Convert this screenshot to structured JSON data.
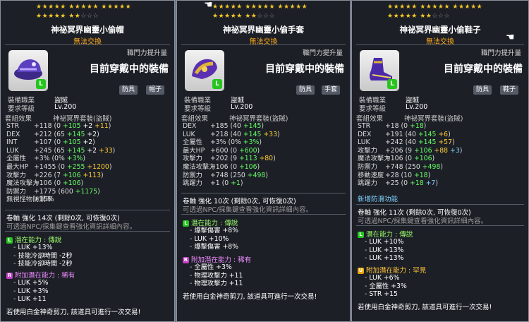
{
  "colors": {
    "title": "#ffffff",
    "untradeable": "#ffaa1e",
    "bonus_green": "#66ff66",
    "bonus_yellow": "#ffcc33",
    "scroll_cyan": "#7fd4ff",
    "legendary": "#26c41f",
    "rare": "#c33ec7",
    "unique": "#e8a600"
  },
  "common": {
    "upgrade_label": "職門力提升量",
    "equipped_label": "目前穿戴中的裝備",
    "job_label": "裝備職業",
    "job_value": "盜賊",
    "level_label": "要求等級",
    "level_value": "Lv.200",
    "set_label": "套組效果",
    "untradeable": "無法交換",
    "upgrade_note": "可透過NPC/採集鍵查看強化資訊詳細內容。",
    "potential_label": "潛在能力 : 傳說",
    "scissors_text": "若使用白金神奇剪刀, 該道具可進行一次交易!"
  },
  "items": [
    {
      "title": "神祕冥界幽靈小偷帽",
      "type_tags": [
        "防具",
        "帽子"
      ],
      "set_name": "神祕冥界套裝(盜賊)",
      "stars_row1": "★★★★★ ★★★★★ ★★★★★",
      "stars_row2": "★★★★★ ★★☆☆☆",
      "stats": [
        {
          "nm": "STR",
          "v": "+118 (0 ",
          "a": "+105",
          "b": "+2",
          "c": "+11",
          ")": ")"
        },
        {
          "nm": "DEX",
          "v": "+212 (65 ",
          "a": "+145",
          "b": "+2",
          ")": ")"
        },
        {
          "nm": "INT",
          "v": "+107 (0 ",
          "a": "+105",
          "b": "+2",
          ")": ")"
        },
        {
          "nm": "LUK",
          "v": "+245 (65 ",
          "a": "+145",
          "b": "+2",
          "c": "+33",
          ")": ")"
        },
        {
          "nm": "全屬性",
          "v": "+3% (0% ",
          "a": "+3%",
          ")": ")"
        },
        {
          "nm": "最大HP",
          "v": "+1455 (0 ",
          "a": "+255",
          "c": "+1200",
          ")": ")"
        },
        {
          "nm": "攻擊力",
          "v": "+226 (7 ",
          "a": "+106",
          "c": "+113",
          ")": ")"
        },
        {
          "nm": "魔法攻擊力",
          "v": "+106 (0 ",
          "a": "+106",
          ")": ")"
        },
        {
          "nm": "防禦力",
          "v": "+1775 (600 ",
          "a": "+1175",
          ")": ")"
        },
        {
          "nm": "無視怪物防禦率",
          "v": " +15%"
        }
      ],
      "upgrade": "卷軸 強化 14次 (剩餘0次, 可恢復0次)",
      "potential_lines": [
        "LUK +13%",
        "技能冷卻時間 -2秒",
        "技能冷卻時間 -2秒"
      ],
      "add_potential_label": "附加潛在能力 : 稀有",
      "add_lines": [
        "LUK +5%",
        "LUK +3%",
        "LUK +11"
      ]
    },
    {
      "title": "神祕冥界幽靈小偷手套",
      "type_tags": [
        "防具",
        "手套"
      ],
      "set_name": "神祕冥界套裝(盜賊)",
      "stars_row1": "★★★★★ ★★★★★ ★★★★★",
      "stars_row2": "★★★★★ ★★☆☆☆",
      "stats": [
        {
          "nm": "DEX",
          "v": "+185 (40 ",
          "a": "+145",
          ")": ")"
        },
        {
          "nm": "LUK",
          "v": "+218 (40 ",
          "a": "+145",
          "c": "+33",
          ")": ")"
        },
        {
          "nm": "全屬性",
          "v": "+3% (0% ",
          "a": "+3%",
          ")": ")"
        },
        {
          "nm": "最大HP",
          "v": "+600 (0 ",
          "a": "+600",
          ")": ")"
        },
        {
          "nm": "攻擊力",
          "v": "+202 (9 ",
          "a": "+113",
          "c": "+80",
          ")": ")"
        },
        {
          "nm": "魔法攻擊力",
          "v": "+106 (0 ",
          "a": "+106",
          ")": ")"
        },
        {
          "nm": "防禦力",
          "v": "+748 (250 ",
          "a": "+498",
          ")": ")"
        },
        {
          "nm": "跳躍力",
          "v": "+1 (0 ",
          "a": "+1",
          ")": ")"
        }
      ],
      "upgrade": "卷軸 強化 10次 (剩餘0次, 可恢復0次)",
      "potential_lines": [
        "爆擊傷害 +8%",
        "LUK +10%",
        "爆擊傷害 +8%"
      ],
      "add_potential_label": "附加潛在能力 : 稀有",
      "add_lines": [
        "全屬性 +3%",
        "物理攻擊力 +11",
        "物理攻擊力 +11"
      ]
    },
    {
      "title": "神祕冥界幽靈小偷鞋子",
      "type_tags": [
        "防具",
        "鞋子"
      ],
      "set_name": "神祕冥界套裝(盜賊)",
      "stars_row1": "★★★★★ ★★★★★ ★★★★★",
      "stars_row2": "★★★★★ ★★☆☆☆",
      "stats": [
        {
          "nm": "STR",
          "v": "+18 (0 ",
          "a": "+18",
          ")": ")"
        },
        {
          "nm": "DEX",
          "v": "+191 (40 ",
          "a": "+145",
          "c": "+6",
          ")": ")"
        },
        {
          "nm": "LUK",
          "v": "+242 (40 ",
          "a": "+145",
          "c": "+57",
          ")": ")"
        },
        {
          "nm": "攻擊力",
          "v": "+206 (9 ",
          "a": "+106",
          "c": "+88",
          "d": "+3",
          ")": ")"
        },
        {
          "nm": "魔法攻擊力",
          "v": "+106 (0 ",
          "a": "+106",
          ")": ")"
        },
        {
          "nm": "防禦力",
          "v": "+748 (250 ",
          "a": "+498",
          ")": ")"
        },
        {
          "nm": "移動速度",
          "v": "+28 (10 ",
          "a": "+18",
          ")": ")"
        },
        {
          "nm": "跳躍力",
          "v": "+25 (0 ",
          "a": "+18",
          "d": "+7",
          ")": ")"
        }
      ],
      "new_function": "新增防滑功能",
      "upgrade": "卷軸 強化 11次 (剩餘0次, 可恢復0次)",
      "potential_lines": [
        "LUK +10%",
        "LUK +13%",
        "LUK +13%"
      ],
      "add_potential_label": "附加潛在能力 : 罕見",
      "add_lines": [
        "LUK +6%",
        "全屬性 +3%",
        "STR +15"
      ]
    }
  ]
}
